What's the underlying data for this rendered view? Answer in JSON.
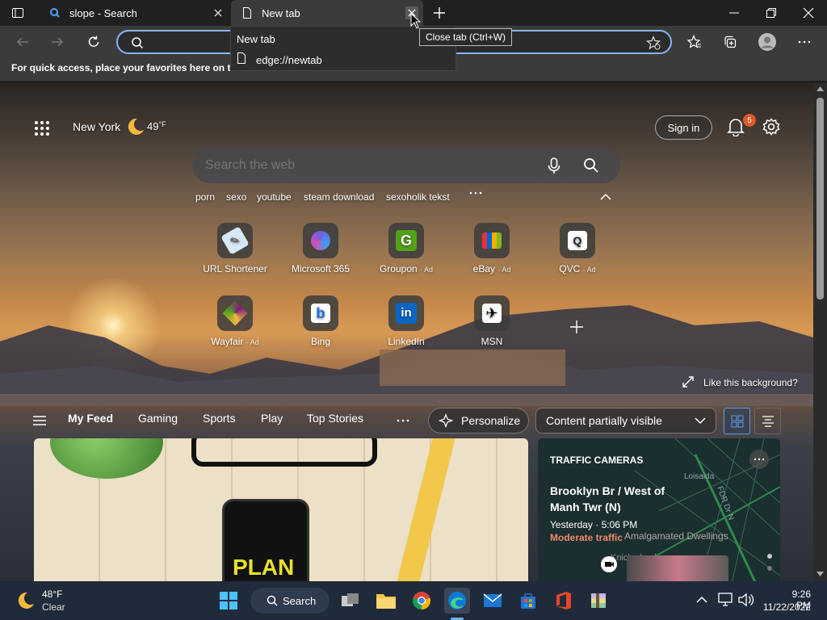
{
  "browser": {
    "tabs": [
      {
        "title": "slope - Search"
      },
      {
        "title": "New tab"
      }
    ],
    "address": {
      "value": "",
      "placeholder": ""
    },
    "favorites_bar_message": "For quick access, place your favorites here on the favorites bar.",
    "tooltip": "Close tab (Ctrl+W)",
    "tab_hover": {
      "title": "New tab",
      "url": "edge://newtab"
    }
  },
  "newtab": {
    "location": "New York",
    "temperature": "49",
    "temp_unit": "°F",
    "sign_in": "Sign in",
    "notifications_count": "5",
    "search_placeholder": "Search the web",
    "suggestions": [
      "porn",
      "sexo",
      "youtube",
      "steam download",
      "sexoholik tekst"
    ],
    "quick_links": [
      {
        "label": "URL Shortener",
        "ad": ""
      },
      {
        "label": "Microsoft 365",
        "ad": ""
      },
      {
        "label": "Groupon",
        "ad": "· Ad"
      },
      {
        "label": "eBay",
        "ad": "· Ad"
      },
      {
        "label": "QVC",
        "ad": "· Ad"
      },
      {
        "label": "Wayfair",
        "ad": "· Ad"
      },
      {
        "label": "Bing",
        "ad": ""
      },
      {
        "label": "LinkedIn",
        "ad": ""
      },
      {
        "label": "MSN",
        "ad": ""
      }
    ],
    "like_background": "Like this background?",
    "feed_tabs": [
      "My Feed",
      "Gaming",
      "Sports",
      "Play",
      "Top Stories"
    ],
    "personalize": "Personalize",
    "content_visibility": "Content partially visible",
    "cards": {
      "main_image_text": "PLAN",
      "traffic": {
        "category": "TRAFFIC CAMERAS",
        "title_line1": "Brooklyn Br / West of",
        "title_line2": "Manh Twr (N)",
        "time": "Yesterday · 5:06 PM",
        "status": "Moderate traffic",
        "map_labels": [
          "Loisaida",
          "FDR Dr N",
          "Amalgamated Dwellings",
          "Knickerbocker"
        ]
      }
    }
  },
  "taskbar": {
    "weather_temp": "48°F",
    "weather_desc": "Clear",
    "search_label": "Search",
    "time": "9:26 PM",
    "date": "11/22/2022"
  },
  "colors": {
    "accent": "#8ab4f8",
    "badge": "#e0582a",
    "traffic_status": "#f08a6a"
  }
}
